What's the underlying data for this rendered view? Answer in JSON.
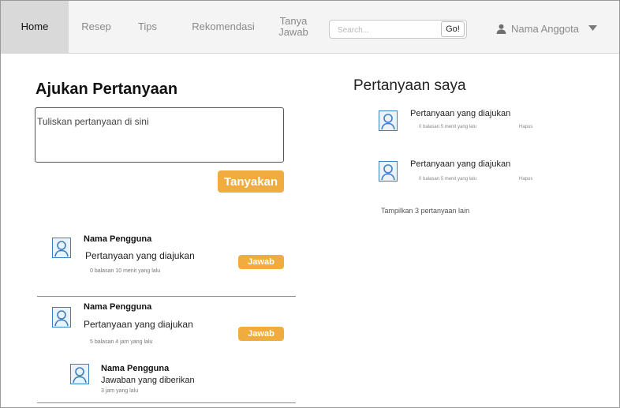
{
  "nav": {
    "items": [
      {
        "label": "Home",
        "active": true
      },
      {
        "label": "Resep",
        "active": false
      },
      {
        "label": "Tips",
        "active": false
      },
      {
        "label": "Rekomendasi",
        "active": false
      },
      {
        "label": "Tanya Jawab",
        "active": false
      }
    ],
    "search_placeholder": "Search...",
    "search_button": "Go!",
    "member_name": "Nama Anggota"
  },
  "ask": {
    "title": "Ajukan Pertanyaan",
    "placeholder": "Tuliskan pertanyaan di sini",
    "submit_label": "Tanyakan"
  },
  "feed": [
    {
      "user": "Nama Pengguna",
      "question": "Pertanyaan yang diajukan",
      "meta": "0 balasan   10 menit yang lalu",
      "answer_label": "Jawab"
    },
    {
      "user": "Nama Pengguna",
      "question": "Pertanyaan yang diajukan",
      "meta": "5 balasan   4 jam yang lalu",
      "answer_label": "Jawab",
      "reply": {
        "user": "Nama Pengguna",
        "text": "Jawaban yang diberikan",
        "meta": "3 jam yang lalu"
      }
    }
  ],
  "mine": {
    "title": "Pertanyaan saya",
    "items": [
      {
        "question": "Pertanyaan yang diajukan",
        "meta": "0 balasan   5 menit yang lalu",
        "delete_label": "Hapus"
      },
      {
        "question": "Pertanyaan yang diajukan",
        "meta": "0 balasan   5 menit yang lalu",
        "delete_label": "Hapus"
      }
    ],
    "show_more": "Tampilkan 3 pertanyaan lain"
  },
  "colors": {
    "accent": "#f0ac3e",
    "avatar_border": "#3b7fc0",
    "nav_bg": "#f4f4f4",
    "nav_active": "#d9d9d9"
  }
}
